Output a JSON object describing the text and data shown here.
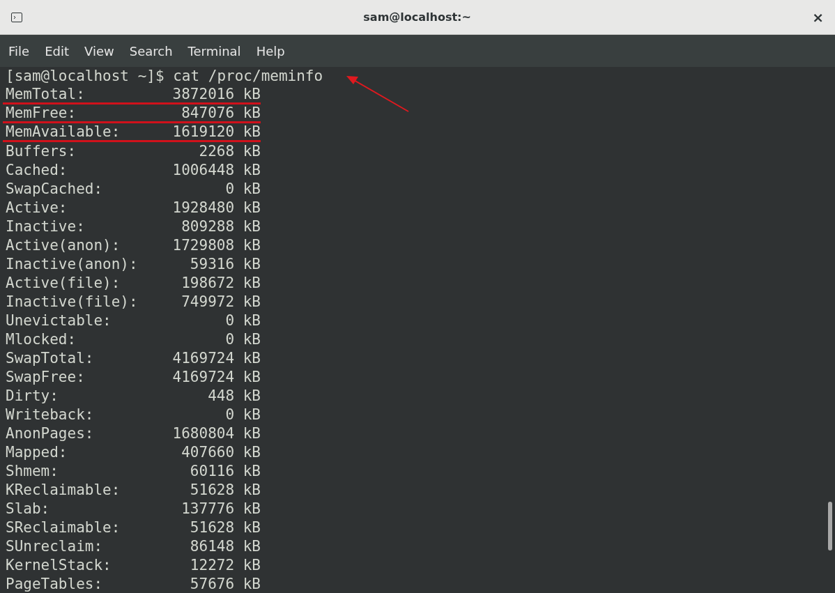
{
  "window": {
    "title": "sam@localhost:~",
    "close": "×"
  },
  "menu": [
    "File",
    "Edit",
    "View",
    "Search",
    "Terminal",
    "Help"
  ],
  "prompt": "[sam@localhost ~]$ cat /proc/meminfo",
  "rows": [
    {
      "label": "MemTotal:",
      "value": "3872016 kB",
      "highlighted": true
    },
    {
      "label": "MemFree:",
      "value": "847076 kB",
      "highlighted": true
    },
    {
      "label": "MemAvailable:",
      "value": "1619120 kB",
      "highlighted": true
    },
    {
      "label": "Buffers:",
      "value": "2268 kB",
      "highlighted": false
    },
    {
      "label": "Cached:",
      "value": "1006448 kB",
      "highlighted": false
    },
    {
      "label": "SwapCached:",
      "value": "0 kB",
      "highlighted": false
    },
    {
      "label": "Active:",
      "value": "1928480 kB",
      "highlighted": false
    },
    {
      "label": "Inactive:",
      "value": "809288 kB",
      "highlighted": false
    },
    {
      "label": "Active(anon):",
      "value": "1729808 kB",
      "highlighted": false
    },
    {
      "label": "Inactive(anon):",
      "value": "59316 kB",
      "highlighted": false
    },
    {
      "label": "Active(file):",
      "value": "198672 kB",
      "highlighted": false
    },
    {
      "label": "Inactive(file):",
      "value": "749972 kB",
      "highlighted": false
    },
    {
      "label": "Unevictable:",
      "value": "0 kB",
      "highlighted": false
    },
    {
      "label": "Mlocked:",
      "value": "0 kB",
      "highlighted": false
    },
    {
      "label": "SwapTotal:",
      "value": "4169724 kB",
      "highlighted": false
    },
    {
      "label": "SwapFree:",
      "value": "4169724 kB",
      "highlighted": false
    },
    {
      "label": "Dirty:",
      "value": "448 kB",
      "highlighted": false
    },
    {
      "label": "Writeback:",
      "value": "0 kB",
      "highlighted": false
    },
    {
      "label": "AnonPages:",
      "value": "1680804 kB",
      "highlighted": false
    },
    {
      "label": "Mapped:",
      "value": "407660 kB",
      "highlighted": false
    },
    {
      "label": "Shmem:",
      "value": "60116 kB",
      "highlighted": false
    },
    {
      "label": "KReclaimable:",
      "value": "51628 kB",
      "highlighted": false
    },
    {
      "label": "Slab:",
      "value": "137776 kB",
      "highlighted": false
    },
    {
      "label": "SReclaimable:",
      "value": "51628 kB",
      "highlighted": false
    },
    {
      "label": "SUnreclaim:",
      "value": "86148 kB",
      "highlighted": false
    },
    {
      "label": "KernelStack:",
      "value": "12272 kB",
      "highlighted": false
    },
    {
      "label": "PageTables:",
      "value": "57676 kB",
      "highlighted": false
    }
  ]
}
